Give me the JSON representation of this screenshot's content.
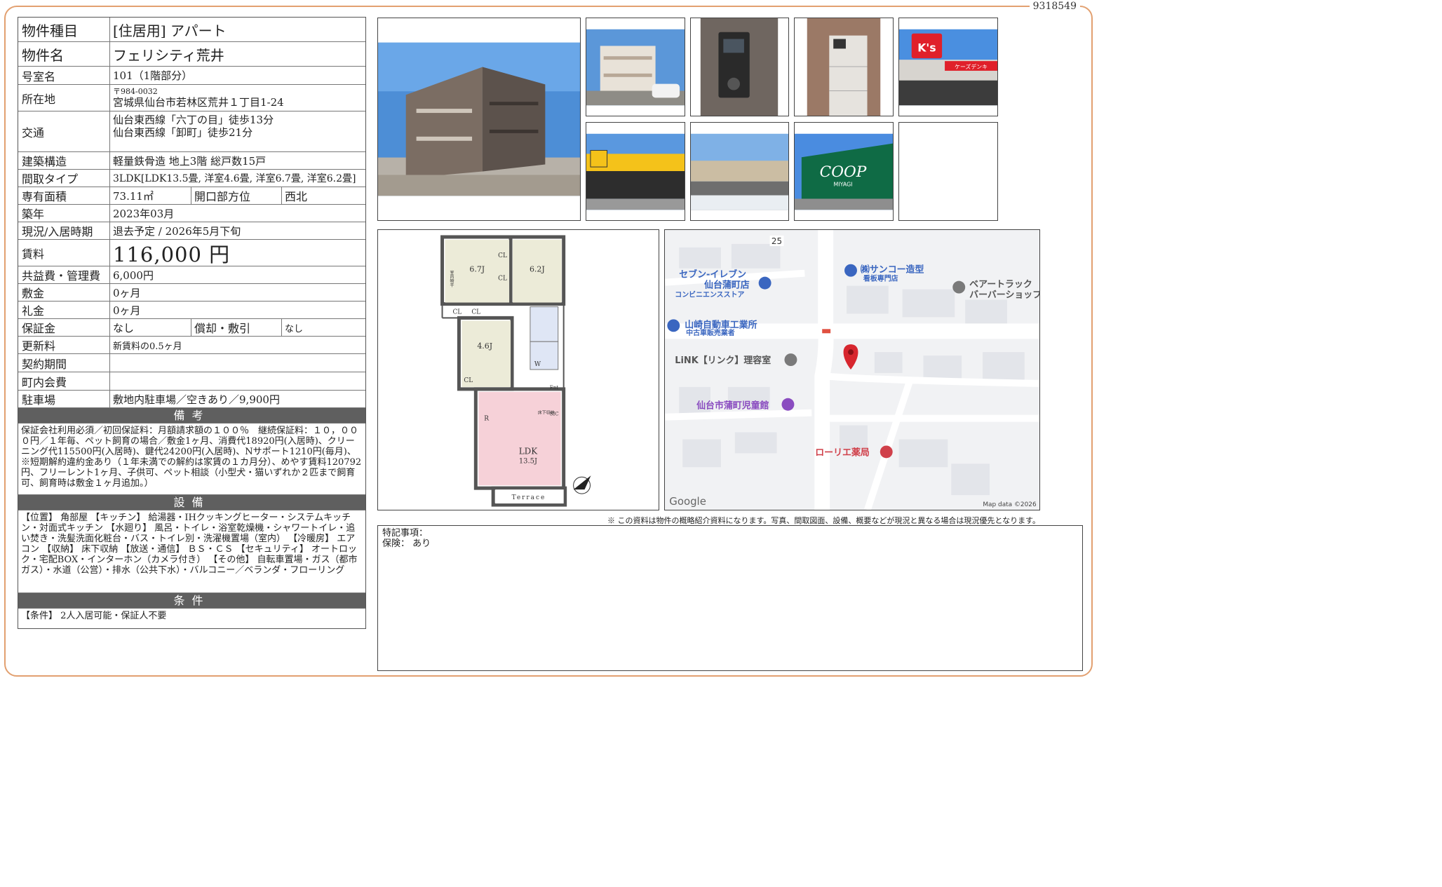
{
  "doc_id": "9318549",
  "property": {
    "type_label": "物件種目",
    "type": "[住居用]  アパート",
    "name_label": "物件名",
    "name": "フェリシティ荒井",
    "room_label": "号室名",
    "room": "101（1階部分）",
    "address_label": "所在地",
    "postal": "〒984-0032",
    "address": "宮城県仙台市若林区荒井１丁目1-24",
    "access_label": "交通",
    "access_1": "仙台東西線「六丁の目」徒歩13分",
    "access_2": "仙台東西線「卸町」徒歩21分",
    "structure_label": "建築構造",
    "structure": "軽量鉄骨造  地上3階  総戸数15戸",
    "layout_label": "間取タイプ",
    "layout": "3LDK[LDK13.5畳, 洋室4.6畳, 洋室6.7畳, 洋室6.2畳]",
    "area_label": "専有面積",
    "area": "73.11㎡",
    "opening_label": "開口部方位",
    "opening": "西北",
    "built_label": "築年",
    "built": "2023年03月",
    "status_label": "現況/入居時期",
    "status": "退去予定  /  2026年5月下旬",
    "rent_label": "賃料",
    "rent": "116,000 円",
    "fee_label": "共益費・管理費",
    "fee": "6,000円",
    "deposit_label": "敷金",
    "deposit": "0ヶ月",
    "key_money_label": "礼金",
    "key_money": "0ヶ月",
    "guarantee_label": "保証金",
    "guarantee": "なし",
    "amort_label": "償却・敷引",
    "amort": "なし",
    "renewal_label": "更新料",
    "renewal": "新賃料の0.5ヶ月",
    "contract_label": "契約期間",
    "contract": "",
    "assoc_label": "町内会費",
    "assoc": "",
    "parking_label": "駐車場",
    "parking": "敷地内駐車場／空きあり／9,900円"
  },
  "sections": {
    "remarks_title": "備考",
    "remarks": "保証会社利用必須／初回保証料：月額請求額の１００％　継続保証料：１０，０００円／１年毎、ペット飼育の場合／敷金1ヶ月、消費代18920円(入居時)、クリーニング代115500円(入居時)、鍵代24200円(入居時)、Nサポート1210円(毎月)、※短期解約違約金あり（１年未満での解約は家賃の１カ月分）、めやす賃料120792円、フリーレント1ヶ月、子供可、ペット相談（小型犬・猫いずれか２匹まで飼育可、飼育時は敷金１ヶ月追加。）",
    "equipment_title": "設備",
    "equipment": "【位置】 角部屋 【キッチン】 給湯器・IHクッキングヒーター・システムキッチン・対面式キッチン 【水廻り】 風呂・トイレ・浴室乾燥機・シャワートイレ・追い焚き・洗髪洗面化粧台・バス・トイレ別・洗濯機置場（室内） 【冷暖房】 エアコン 【収納】 床下収納 【放送・通信】 ＢＳ・ＣＳ 【セキュリティ】 オートロック・宅配BOX・インターホン（カメラ付き） 【その他】 自転車置場・ガス（都市ガス）・水道（公営）・排水（公共下水）・バルコニー／ベランダ・フローリング",
    "conditions_title": "条件",
    "conditions": "【条件】 2人入居可能・保証人不要"
  },
  "floorplan": {
    "rooms": [
      "6.7J",
      "6.2J",
      "4.6J",
      "LDK",
      "13.5J"
    ],
    "closets": [
      "CL",
      "CL",
      "CL",
      "CL",
      "CL"
    ],
    "tags": [
      "W",
      "Ent",
      "SIC",
      "R",
      "床下収納",
      "室内物干"
    ],
    "terrace": "Terrace"
  },
  "map": {
    "road_number": "25",
    "poi": [
      {
        "name": "セブン-イレブン",
        "sub": "仙台蒲町店",
        "desc": "コンビニエンスストア"
      },
      {
        "name": "㈱サンコー造型",
        "desc": "看板専門店"
      },
      {
        "name": "ベアートラック",
        "sub": "バーバーショップ"
      },
      {
        "name": "山崎自動車工業所",
        "desc": "中古車販売業者"
      },
      {
        "name": "LiNK【リンク】理容室"
      },
      {
        "name": "仙台市蒲町児童館"
      },
      {
        "name": "ローリエ薬局"
      }
    ],
    "brand": "Google",
    "attribution": "Map data ©2026"
  },
  "photos": {
    "store_sign_ks": "K's",
    "store_sign_ks_sub": "ケーズデンキ",
    "store_sign_coop": "COOP",
    "store_sign_coop_sub": "MIYAGI"
  },
  "disclaimer": "※  この資料は物件の概略紹介資料になります。写真、間取図面、設備、概要などが現況と異なる場合は現況優先となります。",
  "special_notes": {
    "title": "特記事項：",
    "insurance": "保険：  あり"
  }
}
